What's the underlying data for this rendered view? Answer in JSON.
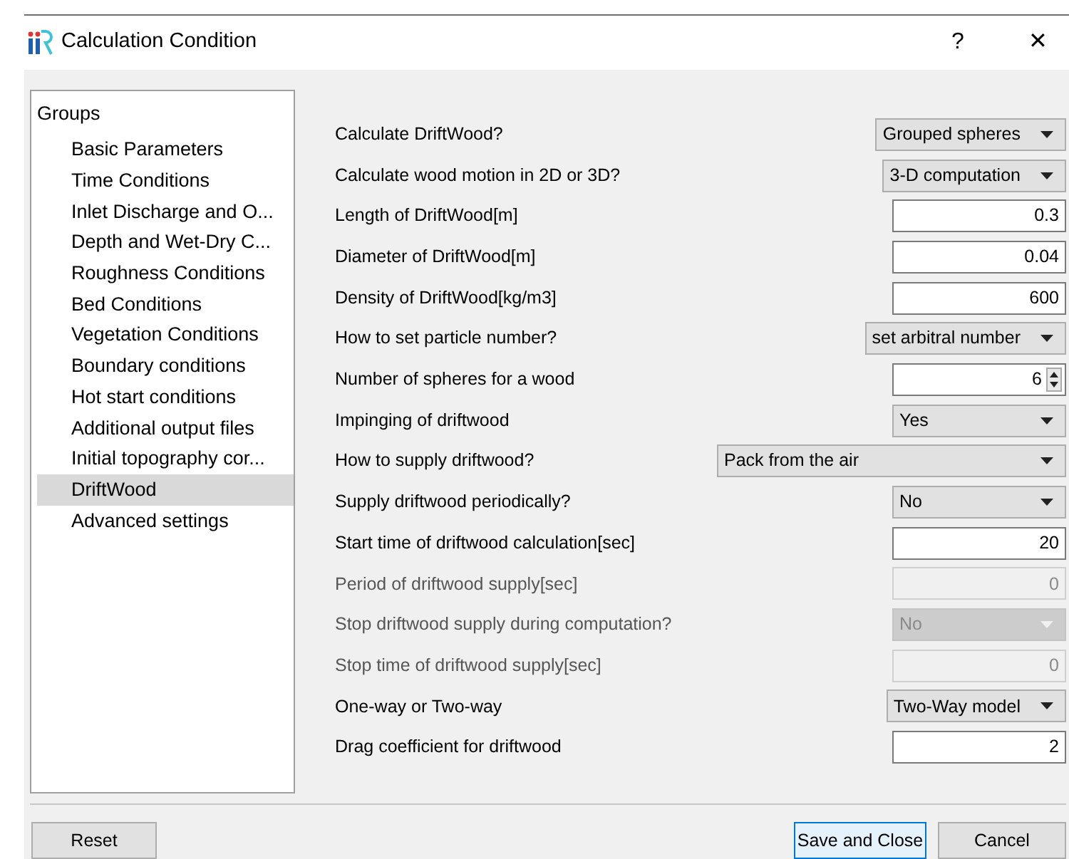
{
  "window": {
    "title": "Calculation Condition",
    "help": "?",
    "close": "✕"
  },
  "groups": {
    "title": "Groups",
    "items": [
      {
        "label": "Basic Parameters",
        "selected": false
      },
      {
        "label": "Time Conditions",
        "selected": false
      },
      {
        "label": "Inlet Discharge and O...",
        "selected": false
      },
      {
        "label": "Depth and Wet-Dry C...",
        "selected": false
      },
      {
        "label": "Roughness Conditions",
        "selected": false
      },
      {
        "label": "Bed Conditions",
        "selected": false
      },
      {
        "label": "Vegetation Conditions",
        "selected": false
      },
      {
        "label": "Boundary conditions",
        "selected": false
      },
      {
        "label": "Hot start conditions",
        "selected": false
      },
      {
        "label": "Additional output files",
        "selected": false
      },
      {
        "label": "Initial topography cor...",
        "selected": false
      },
      {
        "label": "DriftWood",
        "selected": true
      },
      {
        "label": "Advanced settings",
        "selected": false
      }
    ]
  },
  "parameters": [
    {
      "label": "Calculate DriftWood?",
      "kind": "combo",
      "value": "Grouped spheres",
      "disabled": false
    },
    {
      "label": "Calculate wood motion in 2D or 3D?",
      "kind": "combo",
      "value": "3-D computation",
      "disabled": false
    },
    {
      "label": "Length of DriftWood[m]",
      "kind": "text",
      "value": "0.3",
      "disabled": false
    },
    {
      "label": "Diameter of DriftWood[m]",
      "kind": "text",
      "value": "0.04",
      "disabled": false
    },
    {
      "label": "Density of DriftWood[kg/m3]",
      "kind": "text",
      "value": "600",
      "disabled": false
    },
    {
      "label": "How to set particle number?",
      "kind": "combo",
      "value": "set arbitral number",
      "disabled": false
    },
    {
      "label": "Number of spheres for a wood",
      "kind": "spin",
      "value": "6",
      "disabled": false
    },
    {
      "label": "Impinging of driftwood",
      "kind": "combo",
      "value": "Yes",
      "disabled": false
    },
    {
      "label": "How to supply driftwood?",
      "kind": "combo",
      "value": "Pack from the air",
      "disabled": false
    },
    {
      "label": "Supply driftwood periodically?",
      "kind": "combo",
      "value": "No",
      "disabled": false
    },
    {
      "label": "Start time of driftwood calculation[sec]",
      "kind": "text",
      "value": "20",
      "disabled": false
    },
    {
      "label": "Period of driftwood supply[sec]",
      "kind": "text",
      "value": "0",
      "disabled": true
    },
    {
      "label": "Stop driftwood supply during computation?",
      "kind": "combo",
      "value": "No",
      "disabled": true
    },
    {
      "label": "Stop time of driftwood supply[sec]",
      "kind": "text",
      "value": "0",
      "disabled": true
    },
    {
      "label": "One-way or Two-way",
      "kind": "combo",
      "value": "Two-Way model",
      "disabled": false
    },
    {
      "label": "Drag coefficient for driftwood",
      "kind": "text",
      "value": "2",
      "disabled": false
    }
  ],
  "buttons": [
    {
      "label": "Reset",
      "default": false
    },
    {
      "label": "Save and Close",
      "default": true
    },
    {
      "label": "Cancel",
      "default": false
    }
  ]
}
